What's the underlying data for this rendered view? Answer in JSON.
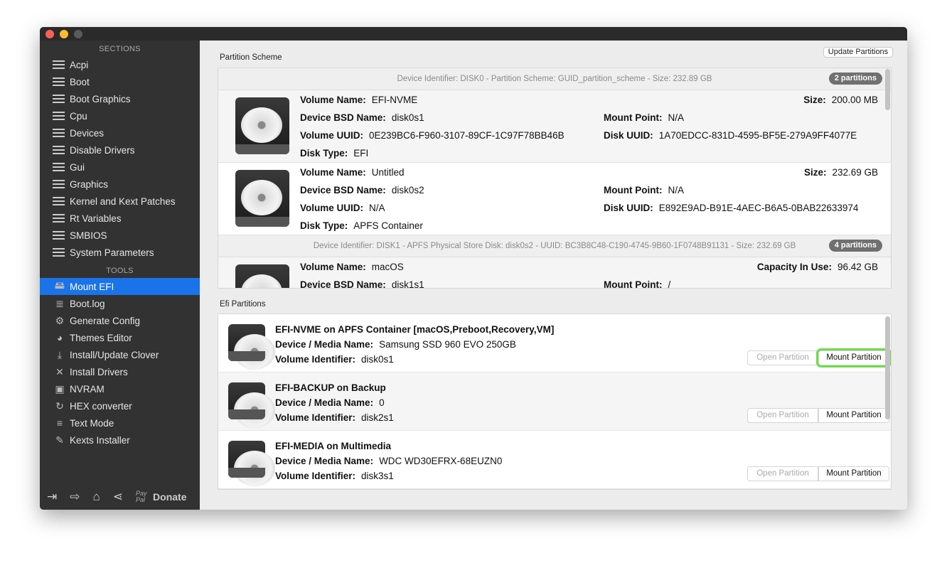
{
  "sidebar": {
    "sections_header": "SECTIONS",
    "sections": [
      "Acpi",
      "Boot",
      "Boot Graphics",
      "Cpu",
      "Devices",
      "Disable Drivers",
      "Gui",
      "Graphics",
      "Kernel and Kext Patches",
      "Rt Variables",
      "SMBIOS",
      "System Parameters"
    ],
    "tools_header": "TOOLS",
    "tools": [
      {
        "label": "Mount EFI",
        "icon": "disk-icon"
      },
      {
        "label": "Boot.log",
        "icon": "log-search-icon"
      },
      {
        "label": "Generate Config",
        "icon": "gears-icon"
      },
      {
        "label": "Themes Editor",
        "icon": "palette-icon"
      },
      {
        "label": "Install/Update Clover",
        "icon": "download-icon"
      },
      {
        "label": "Install Drivers",
        "icon": "tools-icon"
      },
      {
        "label": "NVRAM",
        "icon": "chip-icon"
      },
      {
        "label": "HEX converter",
        "icon": "refresh-icon"
      },
      {
        "label": "Text Mode",
        "icon": "text-icon"
      },
      {
        "label": "Kexts Installer",
        "icon": "plug-icon"
      }
    ],
    "selected_tool": "Mount EFI",
    "footer": {
      "paypal": "Pay Pal",
      "donate": "Donate"
    }
  },
  "main": {
    "partition_scheme_label": "Partition Scheme",
    "update_button": "Update Partitions",
    "efi_label": "Efi Partitions",
    "labels": {
      "volume_name": "Volume Name:",
      "bsd": "Device BSD Name:",
      "vuuid": "Volume UUID:",
      "disk_type": "Disk Type:",
      "size": "Size:",
      "mount": "Mount Point:",
      "duuid": "Disk UUID:",
      "capacity": "Capacity In Use:",
      "media": "Device / Media Name:",
      "vid": "Volume Identifier:"
    },
    "disks": [
      {
        "header": "Device Identifier: DISK0 - Partition Scheme: GUID_partition_scheme - Size: 232.89 GB",
        "badge": "2 partitions",
        "partitions": [
          {
            "volume_name": "EFI-NVME",
            "bsd": "disk0s1",
            "vuuid": "0E239BC6-F960-3107-89CF-1C97F78BB46B",
            "disk_type": "EFI",
            "size": "200.00 MB",
            "mount": "N/A",
            "duuid": "1A70EDCC-831D-4595-BF5E-279A9FF4077E"
          },
          {
            "volume_name": "Untitled",
            "bsd": "disk0s2",
            "vuuid": "N/A",
            "disk_type": "APFS Container",
            "size": "232.69 GB",
            "mount": "N/A",
            "duuid": "E892E9AD-B91E-4AEC-B6A5-0BAB22633974"
          }
        ]
      },
      {
        "header": "Device Identifier: DISK1 - APFS Physical Store Disk: disk0s2 - UUID: BC3B8C48-C190-4745-9B60-1F0748B91131 - Size: 232.69 GB",
        "badge": "4 partitions",
        "partitions": [
          {
            "volume_name": "macOS",
            "bsd": "disk1s1",
            "capacity": "96.42 GB",
            "mount": "/"
          }
        ]
      }
    ],
    "efi": [
      {
        "title": "EFI-NVME on APFS Container [macOS,Preboot,Recovery,VM]",
        "media": "Samsung SSD 960 EVO 250GB",
        "vid": "disk0s1",
        "open": "Open Partition",
        "mount": "Mount Partition"
      },
      {
        "title": "EFI-BACKUP on Backup",
        "media": "0",
        "vid": "disk2s1",
        "open": "Open Partition",
        "mount": "Mount Partition"
      },
      {
        "title": "EFI-MEDIA on Multimedia",
        "media": "WDC WD30EFRX-68EUZN0",
        "vid": "disk3s1",
        "open": "Open Partition",
        "mount": "Mount Partition"
      }
    ]
  }
}
